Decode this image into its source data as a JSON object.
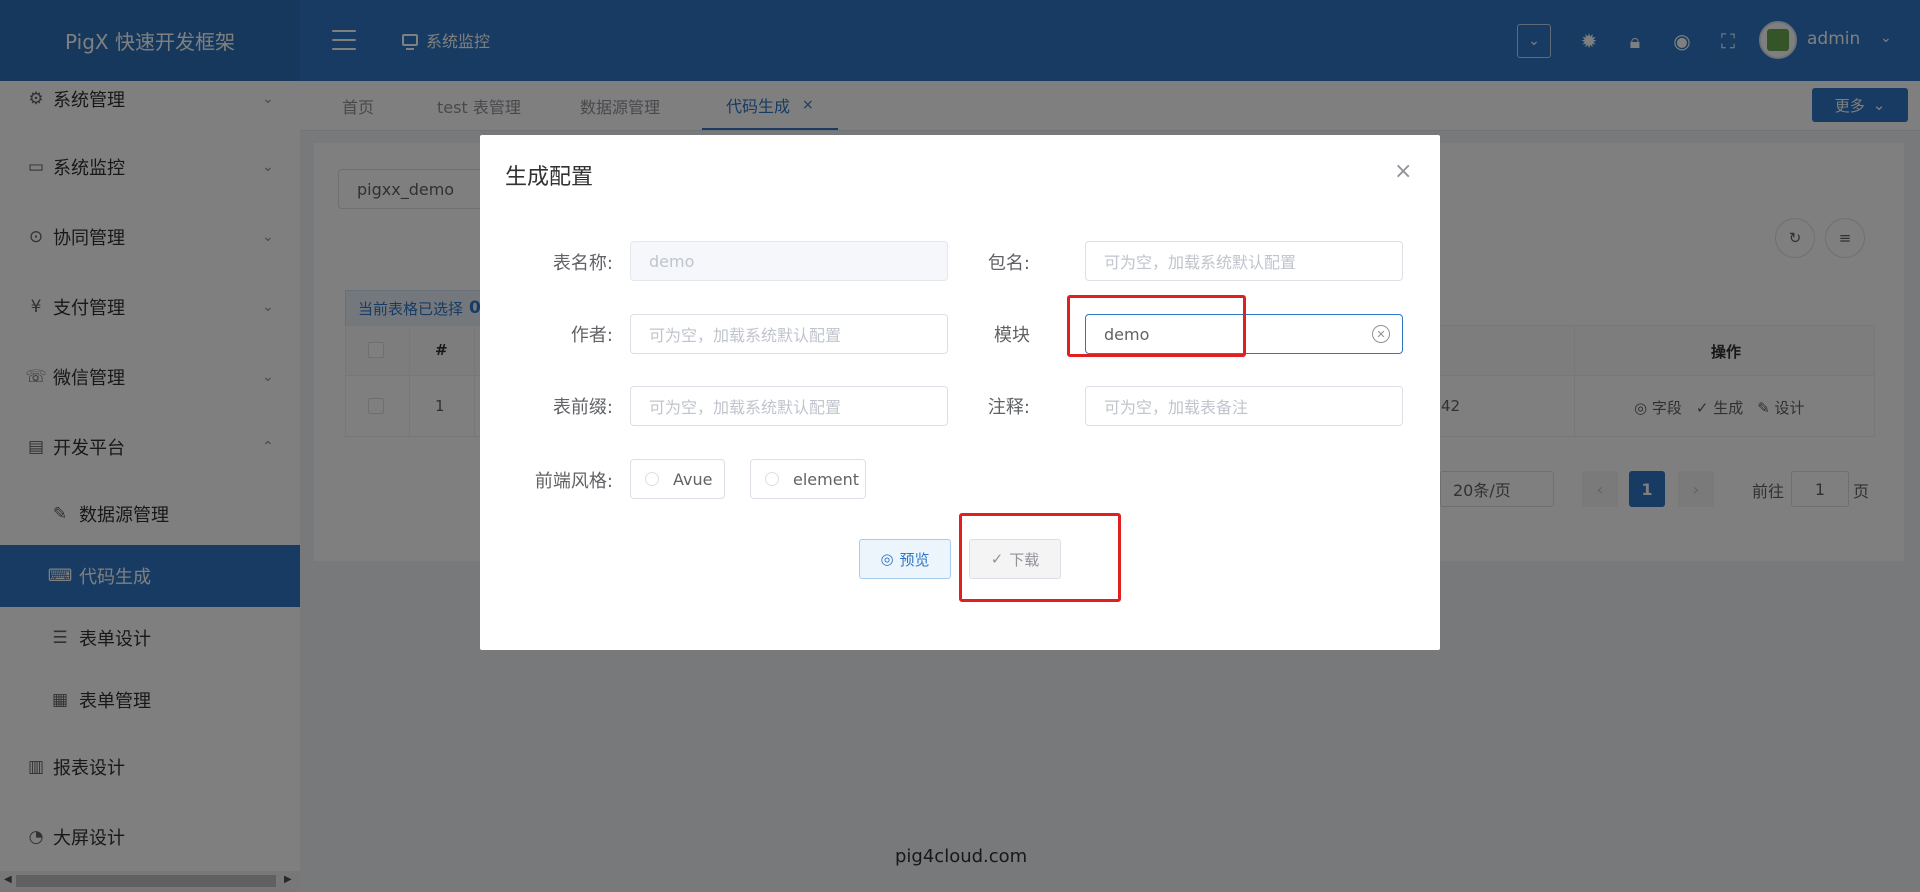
{
  "app": {
    "title": "PigX 快速开发框架",
    "breadcrumb": "系统监控"
  },
  "header": {
    "username": "admin",
    "icons": [
      "dropdown-icon",
      "bug-icon",
      "lock-icon",
      "eye-icon",
      "fullscreen-icon",
      "avatar-image"
    ]
  },
  "sidebar": {
    "items": [
      {
        "label": "系统管理",
        "icon": "gear-icon"
      },
      {
        "label": "系统监控",
        "icon": "monitor-icon"
      },
      {
        "label": "协同管理",
        "icon": "collab-icon"
      },
      {
        "label": "支付管理",
        "icon": "yen-icon"
      },
      {
        "label": "微信管理",
        "icon": "wechat-icon"
      },
      {
        "label": "开发平台",
        "icon": "dev-icon"
      },
      {
        "label": "数据源管理",
        "icon": "datasource-icon"
      },
      {
        "label": "代码生成",
        "icon": "code-icon"
      },
      {
        "label": "表单设计",
        "icon": "form-icon"
      },
      {
        "label": "表单管理",
        "icon": "table-icon"
      },
      {
        "label": "报表设计",
        "icon": "chart-icon"
      },
      {
        "label": "大屏设计",
        "icon": "pie-icon"
      }
    ]
  },
  "tabs": [
    {
      "label": "首页"
    },
    {
      "label": "test 表管理"
    },
    {
      "label": "数据源管理"
    },
    {
      "label": "代码生成",
      "close": "×"
    }
  ],
  "more_button": "更多",
  "content": {
    "datasource_value": "pigxx_demo",
    "selection_note": "当前表格已选择",
    "selection_count": "0",
    "table": {
      "col_index": "#",
      "col_ops": "操作",
      "row_index": "1",
      "row_time_tail": "42",
      "ops": [
        "◎ 字段",
        "✓ 生成",
        "✎ 设计"
      ]
    },
    "pager": {
      "page_size": "20条/页",
      "current_page": "1",
      "goto_label": "前往",
      "goto_value": "1",
      "page_suffix": "页"
    }
  },
  "footer": "pig4cloud.com",
  "dialog": {
    "title": "生成配置",
    "close": "×",
    "fields": {
      "table_name": {
        "label": "表名称:",
        "value": "demo"
      },
      "package": {
        "label": "包名:",
        "placeholder": "可为空，加载系统默认配置"
      },
      "author": {
        "label": "作者:",
        "placeholder": "可为空，加载系统默认配置"
      },
      "module": {
        "label": "模块",
        "value": "demo"
      },
      "prefix": {
        "label": "表前缀:",
        "placeholder": "可为空，加载系统默认配置"
      },
      "comment": {
        "label": "注释:",
        "placeholder": "可为空，加载表备注"
      },
      "style": {
        "label": "前端风格:",
        "options": [
          "Avue",
          "element"
        ]
      }
    },
    "preview_button": "预览",
    "download_button": "下载"
  },
  "colors": {
    "primary": "#2f77c5",
    "annotation": "#e02020",
    "overlay": "rgba(0,0,0,0.5)"
  }
}
